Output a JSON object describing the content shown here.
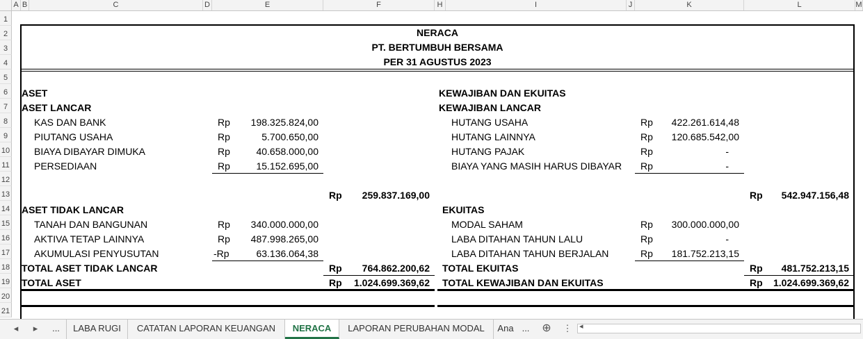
{
  "columns": [
    "A",
    "B",
    "C",
    "D",
    "E",
    "F",
    "H",
    "I",
    "J",
    "K",
    "L",
    "M"
  ],
  "rows": [
    "1",
    "2",
    "3",
    "4",
    "5",
    "6",
    "7",
    "8",
    "9",
    "10",
    "11",
    "12",
    "13",
    "14",
    "15",
    "16",
    "17",
    "18",
    "19",
    "20",
    "21"
  ],
  "header": {
    "title": "NERACA",
    "company": "PT. BERTUMBUH BERSAMA",
    "date": "PER 31 AGUSTUS 2023"
  },
  "assets": {
    "heading": "ASET",
    "current_heading": "ASET LANCAR",
    "current_items": [
      {
        "label": "KAS DAN BANK",
        "cur": "Rp",
        "value": "198.325.824,00"
      },
      {
        "label": "PIUTANG USAHA",
        "cur": "Rp",
        "value": "5.700.650,00"
      },
      {
        "label": "BIAYA DIBAYAR DIMUKA",
        "cur": "Rp",
        "value": "40.658.000,00"
      },
      {
        "label": "PERSEDIAAN",
        "cur": "Rp",
        "value": "15.152.695,00"
      }
    ],
    "current_total": {
      "cur": "Rp",
      "value": "259.837.169,00"
    },
    "noncurrent_heading": "ASET TIDAK LANCAR",
    "noncurrent_items": [
      {
        "label": "TANAH DAN BANGUNAN",
        "cur": "Rp",
        "value": "340.000.000,00"
      },
      {
        "label": "AKTIVA TETAP LAINNYA",
        "cur": "Rp",
        "value": "487.998.265,00"
      },
      {
        "label": "AKUMULASI PENYUSUTAN",
        "cur": "-Rp",
        "value": "63.136.064,38"
      }
    ],
    "noncurrent_total": {
      "label": "TOTAL ASET TIDAK LANCAR",
      "cur": "Rp",
      "value": "764.862.200,62"
    },
    "grand_total": {
      "label": "TOTAL ASET",
      "cur": "Rp",
      "value": "1.024.699.369,62"
    }
  },
  "liabilities": {
    "heading": "KEWAJIBAN DAN EKUITAS",
    "current_heading": "KEWAJIBAN LANCAR",
    "current_items": [
      {
        "label": "HUTANG USAHA",
        "cur": "Rp",
        "value": "422.261.614,48"
      },
      {
        "label": "HUTANG LAINNYA",
        "cur": "Rp",
        "value": "120.685.542,00"
      },
      {
        "label": "HUTANG PAJAK",
        "cur": "Rp",
        "value": "-"
      },
      {
        "label": "BIAYA YANG MASIH HARUS DIBAYAR",
        "cur": "Rp",
        "value": "-"
      }
    ],
    "current_total": {
      "cur": "Rp",
      "value": "542.947.156,48"
    },
    "equity_heading": "EKUITAS",
    "equity_items": [
      {
        "label": "MODAL SAHAM",
        "cur": "Rp",
        "value": "300.000.000,00"
      },
      {
        "label": "LABA DITAHAN TAHUN LALU",
        "cur": "Rp",
        "value": "-"
      },
      {
        "label": "LABA DITAHAN TAHUN BERJALAN",
        "cur": "Rp",
        "value": "181.752.213,15"
      }
    ],
    "equity_total": {
      "label": "TOTAL EKUITAS",
      "cur": "Rp",
      "value": "481.752.213,15"
    },
    "grand_total": {
      "label": "TOTAL KEWAJIBAN DAN EKUITAS",
      "cur": "Rp",
      "value": "1.024.699.369,62"
    }
  },
  "sheet_tabs": {
    "nav_prev": "◂",
    "nav_next": "▸",
    "more_left": "...",
    "tabs": [
      "LABA RUGI",
      "CATATAN LAPORAN KEUANGAN",
      "NERACA",
      "LAPORAN PERUBAHAN MODAL",
      "Ana"
    ],
    "more_right": "...",
    "active": "NERACA",
    "add": "⊕",
    "splitter": "⋮",
    "scroll_left": "◂"
  },
  "colors": {
    "accent": "#217346",
    "grid_header": "#f3f3f3"
  }
}
